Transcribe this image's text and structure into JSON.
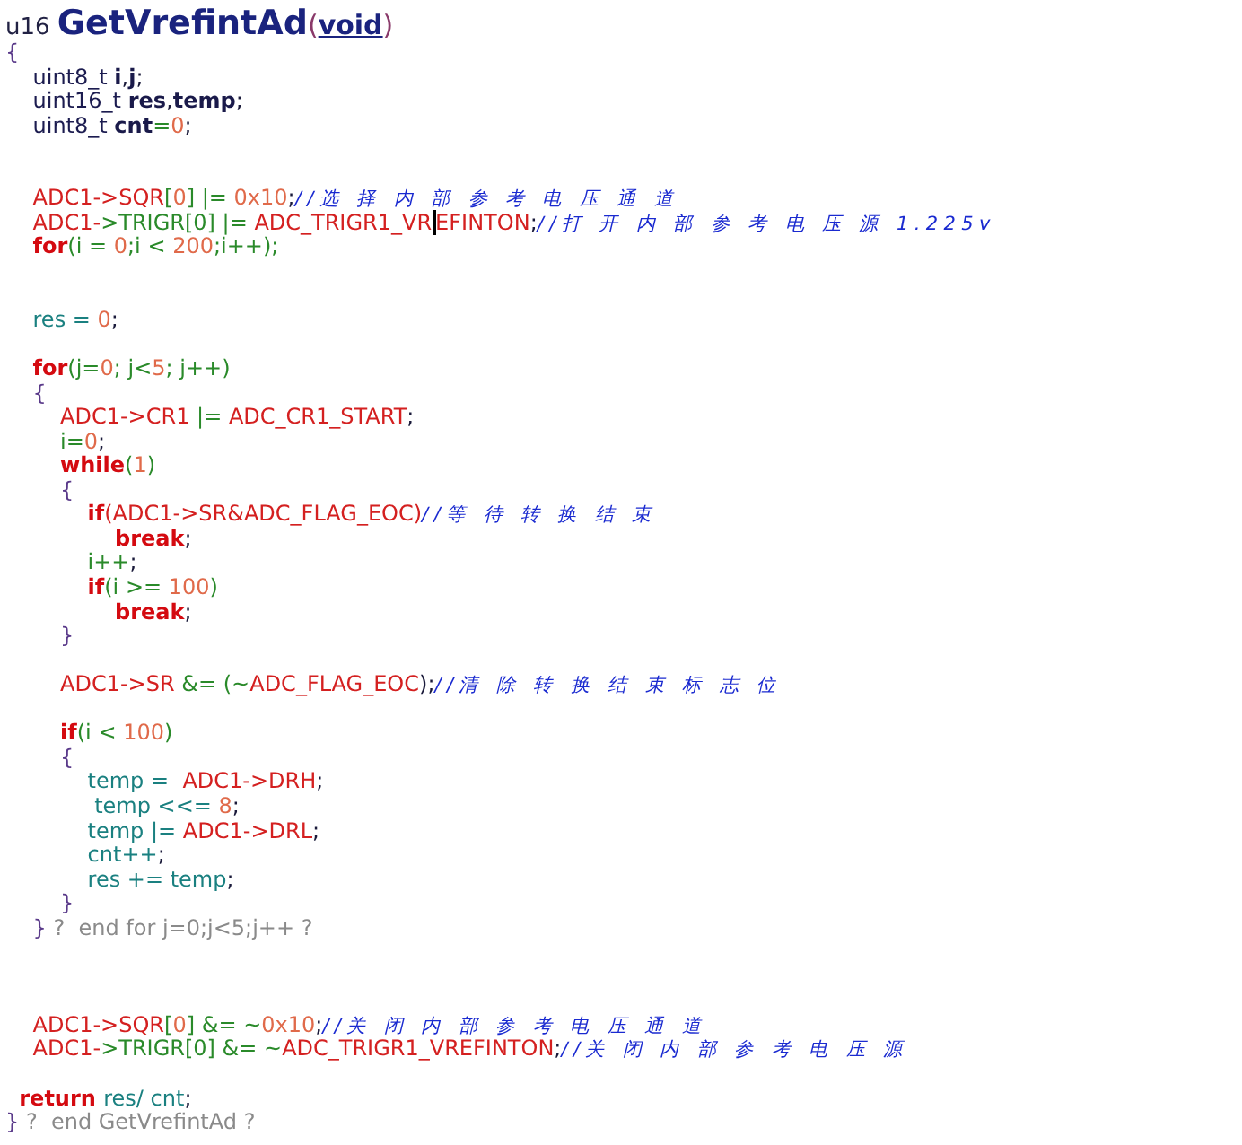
{
  "editor": {
    "lines": [
      {
        "kind": "heading",
        "tokens": [
          {
            "kind": "type",
            "text": "u16 "
          },
          {
            "kind": "fname",
            "text": "GetVrefintAd"
          },
          {
            "kind": "paren",
            "text": "("
          },
          {
            "kind": "void",
            "text": "void"
          },
          {
            "kind": "paren",
            "text": ")"
          }
        ]
      },
      {
        "kind": "code",
        "tokens": [
          {
            "kind": "brace",
            "text": "{"
          }
        ]
      },
      {
        "kind": "code",
        "tokens": [
          {
            "kind": "type",
            "text": "    uint8_t "
          },
          {
            "kind": "var",
            "text": "i"
          },
          {
            "kind": "plain",
            "text": ","
          },
          {
            "kind": "var",
            "text": "j"
          },
          {
            "kind": "plain",
            "text": ";"
          }
        ]
      },
      {
        "kind": "code",
        "tokens": [
          {
            "kind": "type",
            "text": "    uint16_t "
          },
          {
            "kind": "var",
            "text": "res"
          },
          {
            "kind": "plain",
            "text": ","
          },
          {
            "kind": "var",
            "text": "temp"
          },
          {
            "kind": "plain",
            "text": ";"
          }
        ]
      },
      {
        "kind": "code",
        "tokens": [
          {
            "kind": "type",
            "text": "    uint8_t "
          },
          {
            "kind": "var",
            "text": "cnt"
          },
          {
            "kind": "op",
            "text": "="
          },
          {
            "kind": "num",
            "text": "0"
          },
          {
            "kind": "plain",
            "text": ";"
          }
        ]
      },
      {
        "kind": "blank"
      },
      {
        "kind": "blank"
      },
      {
        "kind": "code",
        "tokens": [
          {
            "kind": "reg",
            "text": "    ADC1->SQR"
          },
          {
            "kind": "op",
            "text": "["
          },
          {
            "kind": "num",
            "text": "0"
          },
          {
            "kind": "op",
            "text": "] |= "
          },
          {
            "kind": "num",
            "text": "0x10"
          },
          {
            "kind": "plain",
            "text": ";"
          },
          {
            "kind": "cmt",
            "text": "//选 择 内 部 参 考 电 压 通 道"
          }
        ]
      },
      {
        "kind": "code",
        "tokens": [
          {
            "kind": "reg",
            "text": "    ADC1-"
          },
          {
            "kind": "op",
            "text": ">TRIGR[0] |= "
          },
          {
            "kind": "reg",
            "text": "ADC_TRIGR1_VR"
          },
          {
            "kind": "reg",
            "text": "EFINTON",
            "caret": true
          },
          {
            "kind": "plain",
            "text": ";"
          },
          {
            "kind": "cmt",
            "text": "//打 开 内 部 参 考 电 压 源 1.225v"
          }
        ]
      },
      {
        "kind": "code",
        "tokens": [
          {
            "kind": "kw",
            "text": "    for"
          },
          {
            "kind": "op",
            "text": "(i = "
          },
          {
            "kind": "num",
            "text": "0"
          },
          {
            "kind": "op",
            "text": ";i < "
          },
          {
            "kind": "num",
            "text": "200"
          },
          {
            "kind": "op",
            "text": ";i++);"
          }
        ]
      },
      {
        "kind": "blank"
      },
      {
        "kind": "blank"
      },
      {
        "kind": "code",
        "tokens": [
          {
            "kind": "ident",
            "text": "    res = "
          },
          {
            "kind": "num",
            "text": "0"
          },
          {
            "kind": "plain",
            "text": ";"
          }
        ]
      },
      {
        "kind": "blank"
      },
      {
        "kind": "code",
        "tokens": [
          {
            "kind": "kw",
            "text": "    for"
          },
          {
            "kind": "op",
            "text": "(j="
          },
          {
            "kind": "num",
            "text": "0"
          },
          {
            "kind": "op",
            "text": "; j<"
          },
          {
            "kind": "num",
            "text": "5"
          },
          {
            "kind": "op",
            "text": "; j++)"
          }
        ]
      },
      {
        "kind": "code",
        "tokens": [
          {
            "kind": "brace",
            "text": "    {"
          }
        ]
      },
      {
        "kind": "code",
        "tokens": [
          {
            "kind": "reg",
            "text": "        ADC1->CR1 "
          },
          {
            "kind": "op",
            "text": "|= "
          },
          {
            "kind": "reg",
            "text": "ADC_CR1_START"
          },
          {
            "kind": "plain",
            "text": ";"
          }
        ]
      },
      {
        "kind": "code",
        "tokens": [
          {
            "kind": "op",
            "text": "        i="
          },
          {
            "kind": "num",
            "text": "0"
          },
          {
            "kind": "plain",
            "text": ";"
          }
        ]
      },
      {
        "kind": "code",
        "tokens": [
          {
            "kind": "kw",
            "text": "        while"
          },
          {
            "kind": "op",
            "text": "("
          },
          {
            "kind": "num",
            "text": "1"
          },
          {
            "kind": "op",
            "text": ")"
          }
        ]
      },
      {
        "kind": "code",
        "tokens": [
          {
            "kind": "brace",
            "text": "        {"
          }
        ]
      },
      {
        "kind": "code",
        "tokens": [
          {
            "kind": "kw",
            "text": "            if"
          },
          {
            "kind": "reg",
            "text": "(ADC1->SR&ADC_FLAG_EOC)"
          },
          {
            "kind": "cmt",
            "text": "//等 待 转 换 结 束"
          }
        ]
      },
      {
        "kind": "code",
        "tokens": [
          {
            "kind": "kw",
            "text": "                break"
          },
          {
            "kind": "plain",
            "text": ";"
          }
        ]
      },
      {
        "kind": "code",
        "tokens": [
          {
            "kind": "op",
            "text": "            i++"
          },
          {
            "kind": "plain",
            "text": ";"
          }
        ]
      },
      {
        "kind": "code",
        "tokens": [
          {
            "kind": "kw",
            "text": "            if"
          },
          {
            "kind": "op",
            "text": "(i >= "
          },
          {
            "kind": "num",
            "text": "100"
          },
          {
            "kind": "op",
            "text": ")"
          }
        ]
      },
      {
        "kind": "code",
        "tokens": [
          {
            "kind": "kw",
            "text": "                break"
          },
          {
            "kind": "plain",
            "text": ";"
          }
        ]
      },
      {
        "kind": "code",
        "tokens": [
          {
            "kind": "brace",
            "text": "        }"
          }
        ]
      },
      {
        "kind": "blank"
      },
      {
        "kind": "code",
        "tokens": [
          {
            "kind": "reg",
            "text": "        ADC1->SR "
          },
          {
            "kind": "op",
            "text": "&= (~"
          },
          {
            "kind": "reg",
            "text": "ADC_FLAG_EOC"
          },
          {
            "kind": "plain",
            "text": ");"
          },
          {
            "kind": "cmt",
            "text": "//清 除 转 换 结 束 标 志 位"
          }
        ]
      },
      {
        "kind": "blank"
      },
      {
        "kind": "code",
        "tokens": [
          {
            "kind": "kw",
            "text": "        if"
          },
          {
            "kind": "op",
            "text": "(i < "
          },
          {
            "kind": "num",
            "text": "100"
          },
          {
            "kind": "op",
            "text": ")"
          }
        ]
      },
      {
        "kind": "code",
        "tokens": [
          {
            "kind": "brace",
            "text": "        {"
          }
        ]
      },
      {
        "kind": "code",
        "tokens": [
          {
            "kind": "ident",
            "text": "            temp =  "
          },
          {
            "kind": "reg",
            "text": "ADC1->DRH"
          },
          {
            "kind": "plain",
            "text": ";"
          }
        ]
      },
      {
        "kind": "code",
        "tokens": [
          {
            "kind": "ident",
            "text": "             temp <<= "
          },
          {
            "kind": "num",
            "text": "8"
          },
          {
            "kind": "plain",
            "text": ";"
          }
        ]
      },
      {
        "kind": "code",
        "tokens": [
          {
            "kind": "ident",
            "text": "            temp |= "
          },
          {
            "kind": "reg",
            "text": "ADC1->DRL"
          },
          {
            "kind": "plain",
            "text": ";"
          }
        ]
      },
      {
        "kind": "code",
        "tokens": [
          {
            "kind": "ident",
            "text": "            cnt++"
          },
          {
            "kind": "plain",
            "text": ";"
          }
        ]
      },
      {
        "kind": "code",
        "tokens": [
          {
            "kind": "ident",
            "text": "            res += temp"
          },
          {
            "kind": "plain",
            "text": ";"
          }
        ]
      },
      {
        "kind": "code",
        "tokens": [
          {
            "kind": "brace",
            "text": "        }"
          }
        ]
      },
      {
        "kind": "code",
        "tokens": [
          {
            "kind": "brace",
            "text": "    }"
          },
          {
            "kind": "end",
            "text": " ?  end for j=0;j<5;j++ ?"
          }
        ]
      },
      {
        "kind": "blank"
      },
      {
        "kind": "blank"
      },
      {
        "kind": "blank"
      },
      {
        "kind": "code",
        "tokens": [
          {
            "kind": "reg",
            "text": "    ADC1->SQR"
          },
          {
            "kind": "op",
            "text": "["
          },
          {
            "kind": "num",
            "text": "0"
          },
          {
            "kind": "op",
            "text": "] &= ~"
          },
          {
            "kind": "num",
            "text": "0x10"
          },
          {
            "kind": "plain",
            "text": ";"
          },
          {
            "kind": "cmt",
            "text": "//关 闭 内 部 参 考 电 压 通 道"
          }
        ]
      },
      {
        "kind": "code",
        "tokens": [
          {
            "kind": "reg",
            "text": "    ADC1-"
          },
          {
            "kind": "op",
            "text": ">TRIGR[0] &= ~"
          },
          {
            "kind": "reg",
            "text": "ADC_TRIGR1_VREFINTON"
          },
          {
            "kind": "plain",
            "text": ";"
          },
          {
            "kind": "cmt",
            "text": "//关 闭 内 部 参 考 电 压 源"
          }
        ]
      },
      {
        "kind": "blank"
      },
      {
        "kind": "code",
        "tokens": [
          {
            "kind": "kw",
            "text": "  return "
          },
          {
            "kind": "ident",
            "text": "res/ cnt"
          },
          {
            "kind": "plain",
            "text": ";"
          }
        ]
      },
      {
        "kind": "code",
        "tokens": [
          {
            "kind": "brace",
            "text": "}"
          },
          {
            "kind": "end",
            "text": " ?  end GetVrefintAd ?"
          }
        ]
      }
    ]
  }
}
